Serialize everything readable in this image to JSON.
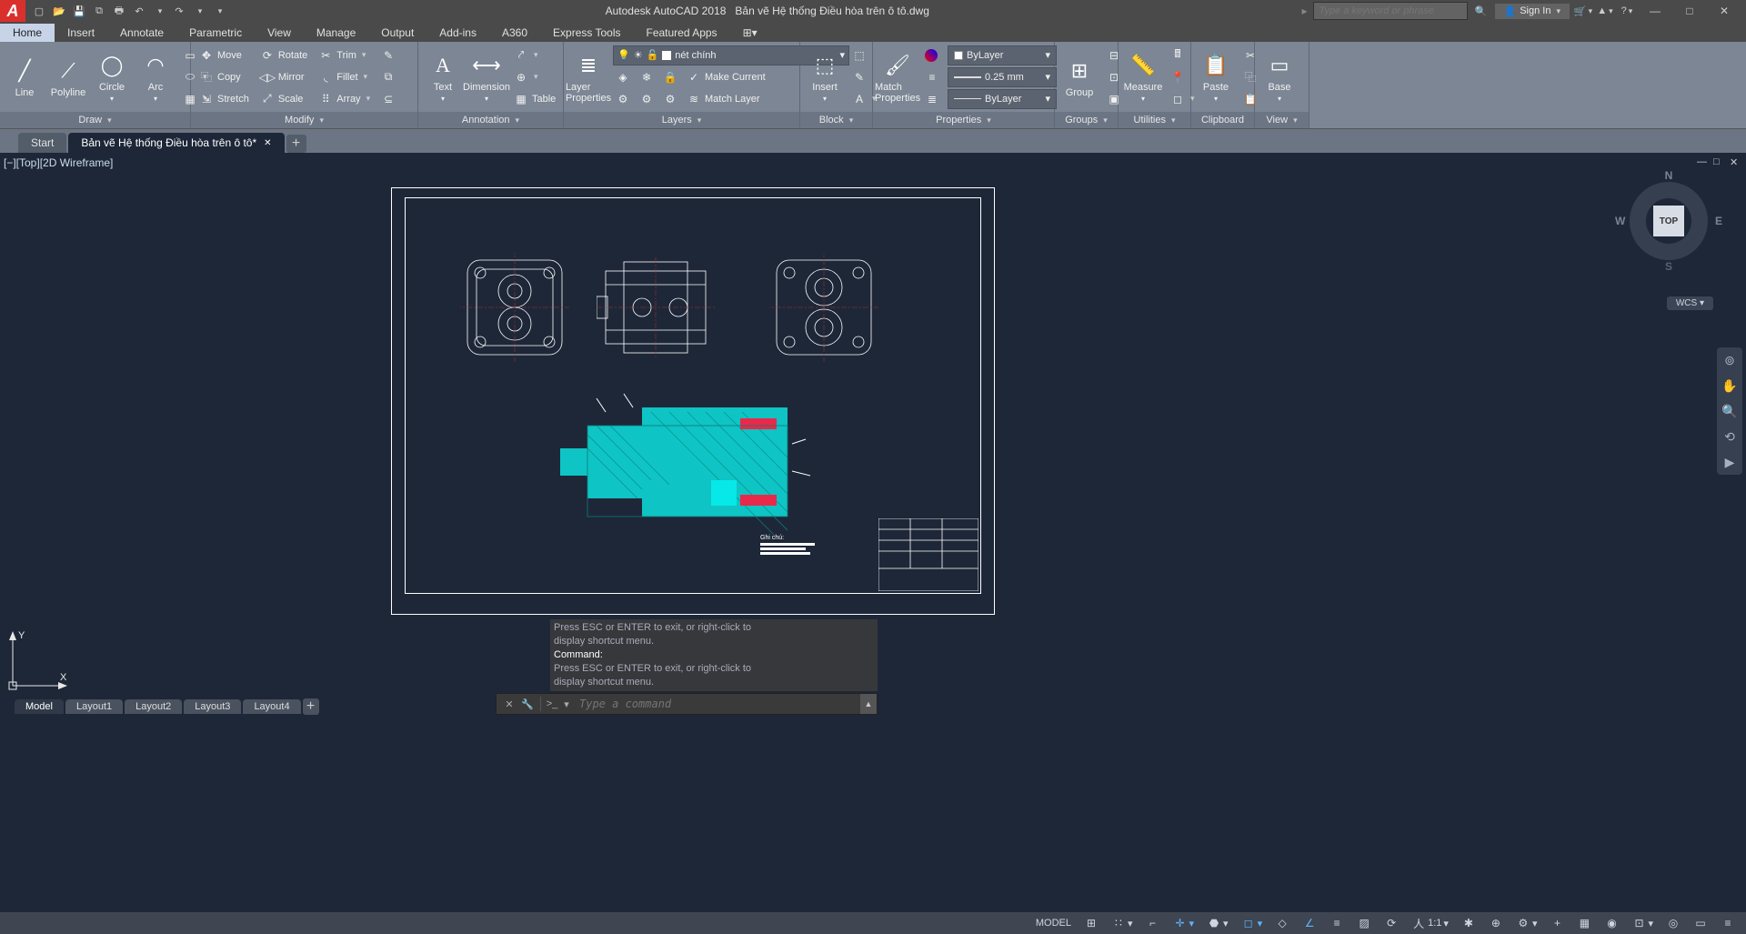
{
  "app": {
    "name": "Autodesk AutoCAD 2018",
    "filename": "Bản vẽ Hệ thống Điều hòa trên ô tô.dwg"
  },
  "search": {
    "placeholder": "Type a keyword or phrase"
  },
  "signin": {
    "label": "Sign In"
  },
  "tabs": [
    "Home",
    "Insert",
    "Annotate",
    "Parametric",
    "View",
    "Manage",
    "Output",
    "Add-ins",
    "A360",
    "Express Tools",
    "Featured Apps"
  ],
  "ribbon": {
    "draw": {
      "line": "Line",
      "polyline": "Polyline",
      "circle": "Circle",
      "arc": "Arc",
      "label": "Draw"
    },
    "modify": {
      "move": "Move",
      "rotate": "Rotate",
      "trim": "Trim",
      "copy": "Copy",
      "mirror": "Mirror",
      "fillet": "Fillet",
      "stretch": "Stretch",
      "scale": "Scale",
      "array": "Array",
      "label": "Modify"
    },
    "annotation": {
      "text": "Text",
      "dimension": "Dimension",
      "table": "Table",
      "label": "Annotation"
    },
    "layers": {
      "properties": "Layer\nProperties",
      "current_layer": "nét chính",
      "make_current": "Make Current",
      "match_layer": "Match Layer",
      "label": "Layers"
    },
    "block": {
      "insert": "Insert",
      "label": "Block"
    },
    "properties": {
      "match": "Match\nProperties",
      "bylayer": "ByLayer",
      "lineweight": "0.25 mm",
      "linetype": "ByLayer",
      "label": "Properties"
    },
    "groups": {
      "group": "Group",
      "label": "Groups"
    },
    "utilities": {
      "measure": "Measure",
      "label": "Utilities"
    },
    "clipboard": {
      "paste": "Paste",
      "label": "Clipboard"
    },
    "view": {
      "base": "Base",
      "label": "View"
    }
  },
  "filetabs": {
    "start": "Start",
    "file": "Bản vẽ Hệ thống Điều hòa trên ô tô*"
  },
  "viewport": {
    "controls": "[−][Top][2D Wireframe]"
  },
  "viewcube": {
    "top": "TOP",
    "n": "N",
    "s": "S",
    "e": "E",
    "w": "W",
    "wcs": "WCS"
  },
  "ucs": {
    "x": "X",
    "y": "Y"
  },
  "cmd": {
    "hist1": "Press ESC or ENTER to exit, or right-click to",
    "hist2": "display shortcut menu.",
    "hist3": "Command:",
    "hist4": "Press ESC or ENTER to exit, or right-click to",
    "hist5": "display shortcut menu.",
    "placeholder": "Type a command",
    "prompt": ">_"
  },
  "layouts": [
    "Model",
    "Layout1",
    "Layout2",
    "Layout3",
    "Layout4"
  ],
  "status": {
    "model": "MODEL",
    "scale": "1:1"
  },
  "notes": {
    "label": "Ghi chú:"
  }
}
